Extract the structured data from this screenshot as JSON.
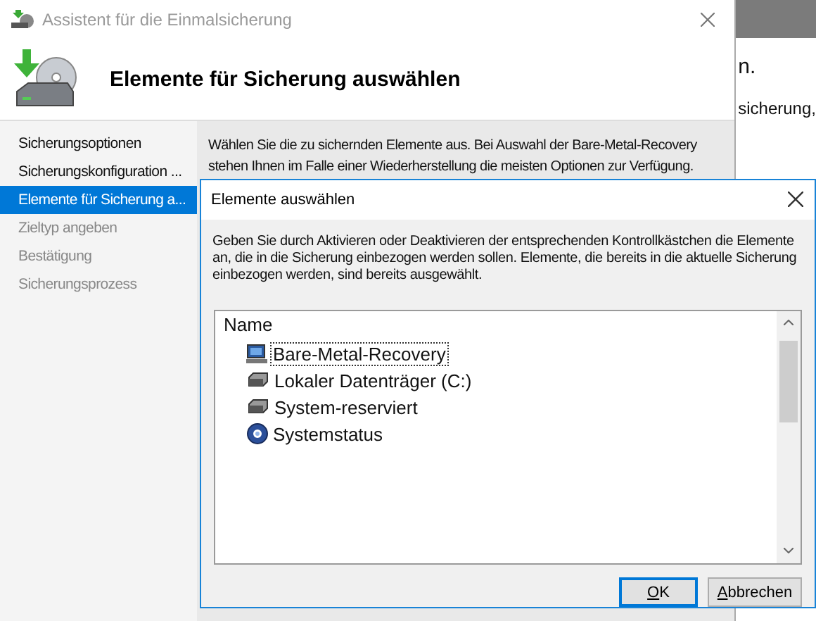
{
  "background_window": {
    "texts": [
      "n.",
      "sicherung,"
    ]
  },
  "window": {
    "title": "Assistent für die Einmalsicherung",
    "heading": "Elemente für Sicherung auswählen"
  },
  "sidebar": {
    "items": [
      {
        "label": "Sicherungsoptionen",
        "selected": false,
        "disabled": false
      },
      {
        "label": "Sicherungskonfiguration ...",
        "selected": false,
        "disabled": false
      },
      {
        "label": "Elemente für Sicherung a...",
        "selected": true,
        "disabled": false
      },
      {
        "label": "Zieltyp angeben",
        "selected": false,
        "disabled": true
      },
      {
        "label": "Bestätigung",
        "selected": false,
        "disabled": true
      },
      {
        "label": "Sicherungsprozess",
        "selected": false,
        "disabled": true
      }
    ]
  },
  "content": {
    "description": "Wählen Sie die zu sichernden Elemente aus. Bei Auswahl der Bare-Metal-Recovery stehen Ihnen im Falle einer Wiederherstellung die meisten Optionen zur Verfügung."
  },
  "dialog": {
    "title": "Elemente auswählen",
    "description": "Geben Sie durch Aktivieren oder Deaktivieren der entsprechenden Kontrollkästchen die Elemente an, die in die Sicherung einbezogen werden sollen. Elemente, die bereits in die aktuelle Sicherung einbezogen werden, sind bereits ausgewählt.",
    "tree": {
      "column": "Name",
      "items": [
        {
          "label": "Bare-Metal-Recovery",
          "kind": "computer",
          "selected": true
        },
        {
          "label": "Lokaler Datenträger (C:)",
          "kind": "drive",
          "selected": false
        },
        {
          "label": "System-reserviert",
          "kind": "drive",
          "selected": false
        },
        {
          "label": "Systemstatus",
          "kind": "gear",
          "selected": false
        }
      ]
    },
    "buttons": [
      {
        "label": "OK",
        "default": true
      },
      {
        "label": "Abbrechen",
        "default": false
      }
    ]
  }
}
